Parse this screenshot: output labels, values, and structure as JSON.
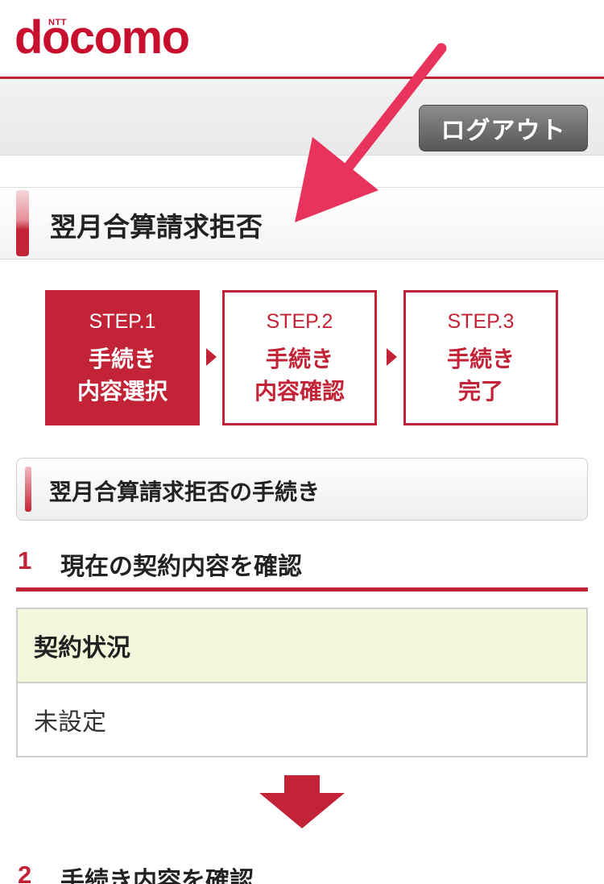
{
  "brand": {
    "ntt": "NTT",
    "logo": "docomo"
  },
  "header": {
    "logout_label": "ログアウト"
  },
  "page": {
    "title": "翌月合算請求拒否"
  },
  "steps": [
    {
      "num": "STEP.1",
      "label": "手続き\n内容選択",
      "active": true
    },
    {
      "num": "STEP.2",
      "label": "手続き\n内容確認",
      "active": false
    },
    {
      "num": "STEP.3",
      "label": "手続き\n完了",
      "active": false
    }
  ],
  "procedure": {
    "heading": "翌月合算請求拒否の手続き"
  },
  "section1": {
    "number": "1",
    "label": "現在の契約内容を確認"
  },
  "contract": {
    "header": "契約状況",
    "value": "未設定"
  },
  "section2": {
    "number": "2",
    "label": "手続き内容を確認"
  },
  "colors": {
    "brand_red": "#c32336",
    "annotation_arrow": "#e8345c",
    "table_head_bg": "#f4f7dc"
  }
}
